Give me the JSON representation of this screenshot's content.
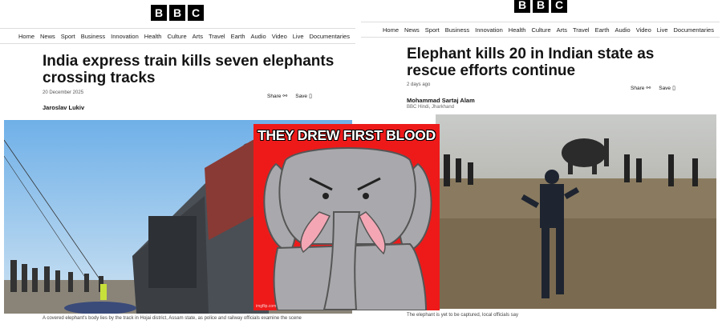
{
  "bbc_logo": [
    "B",
    "B",
    "C"
  ],
  "nav_items": [
    "Home",
    "News",
    "Sport",
    "Business",
    "Innovation",
    "Health",
    "Culture",
    "Arts",
    "Travel",
    "Earth",
    "Audio",
    "Video",
    "Live",
    "Documentaries"
  ],
  "left_article": {
    "headline_line1": "India express train kills seven elephants",
    "headline_line2": "crossing tracks",
    "date": "20 December 2025",
    "author": "Jaroslav Lukiv",
    "share_label": "Share",
    "save_label": "Save",
    "caption": "A covered elephant's body lies by the track in Hojai district, Assam state, as police and railway officials examine the scene"
  },
  "right_article": {
    "headline_line1": "Elephant kills 20 in Indian state as",
    "headline_line2": "rescue efforts continue",
    "date": "2 days ago",
    "author": "Mohammad Sartaj Alam",
    "author_sub": "BBC Hindi, Jharkhand",
    "share_label": "Share",
    "save_label": "Save",
    "caption": "The elephant is yet to be captured, local officials say"
  },
  "meme": {
    "title": "THEY DREW FIRST BLOOD",
    "watermark": "imgflip.com"
  },
  "colors": {
    "meme_red": "#ee1a1a",
    "elephant_gray": "#a9a9ad",
    "tusk_pink": "#f4a6b4"
  }
}
